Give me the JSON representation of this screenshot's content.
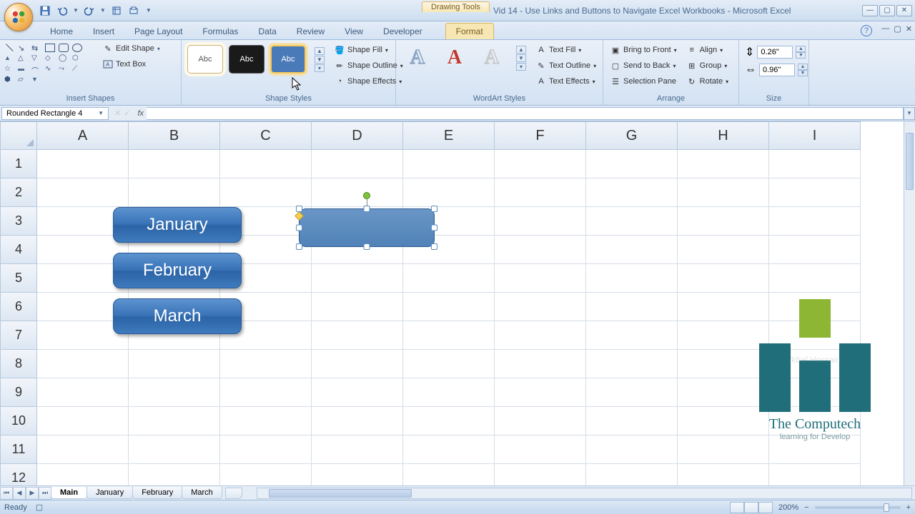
{
  "titlebar": {
    "drawing_tools": "Drawing Tools",
    "title": "Vid 14 - Use Links and Buttons to Navigate Excel Workbooks - Microsoft Excel"
  },
  "tabs": {
    "home": "Home",
    "insert": "Insert",
    "page_layout": "Page Layout",
    "formulas": "Formulas",
    "data": "Data",
    "review": "Review",
    "view": "View",
    "developer": "Developer",
    "format": "Format"
  },
  "ribbon": {
    "insert_shapes": {
      "label": "Insert Shapes",
      "edit_shape": "Edit Shape",
      "text_box": "Text Box"
    },
    "shape_styles": {
      "label": "Shape Styles",
      "swatch_text": "Abc",
      "shape_fill": "Shape Fill",
      "shape_outline": "Shape Outline",
      "shape_effects": "Shape Effects"
    },
    "wordart": {
      "label": "WordArt Styles",
      "letter": "A",
      "text_fill": "Text Fill",
      "text_outline": "Text Outline",
      "text_effects": "Text Effects"
    },
    "arrange": {
      "label": "Arrange",
      "bring_front": "Bring to Front",
      "send_back": "Send to Back",
      "selection_pane": "Selection Pane",
      "align": "Align",
      "group": "Group",
      "rotate": "Rotate"
    },
    "size": {
      "label": "Size",
      "height": "0.26\"",
      "width": "0.96\""
    }
  },
  "name_box": "Rounded Rectangle 4",
  "columns": [
    "A",
    "B",
    "C",
    "D",
    "E",
    "F",
    "G",
    "H",
    "I"
  ],
  "rows": [
    "1",
    "2",
    "3",
    "4",
    "5",
    "6",
    "7",
    "8",
    "9",
    "10",
    "11",
    "12"
  ],
  "shapes": {
    "jan": "January",
    "feb": "February",
    "mar": "March"
  },
  "logo": {
    "title": "The Computech",
    "subtitle": "learning for Develop",
    "watermark": "Ikbal Hossain"
  },
  "sheet_tabs": {
    "main": "Main",
    "jan": "January",
    "feb": "February",
    "mar": "March"
  },
  "status": {
    "ready": "Ready",
    "zoom": "200%"
  }
}
